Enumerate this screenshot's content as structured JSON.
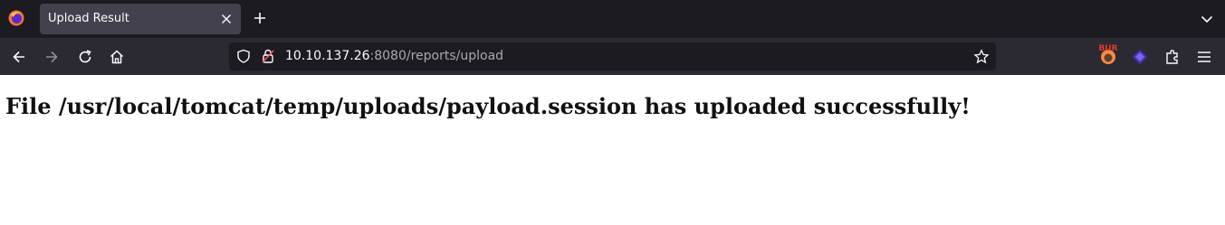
{
  "browser": {
    "tab": {
      "title": "Upload Result"
    },
    "address": {
      "host": "10.10.137.26",
      "rest": ":8080/reports/upload"
    },
    "extensions": {
      "burp_label": "BUR"
    }
  },
  "page": {
    "message": "File /usr/local/tomcat/temp/uploads/payload.session has uploaded successfully!"
  }
}
